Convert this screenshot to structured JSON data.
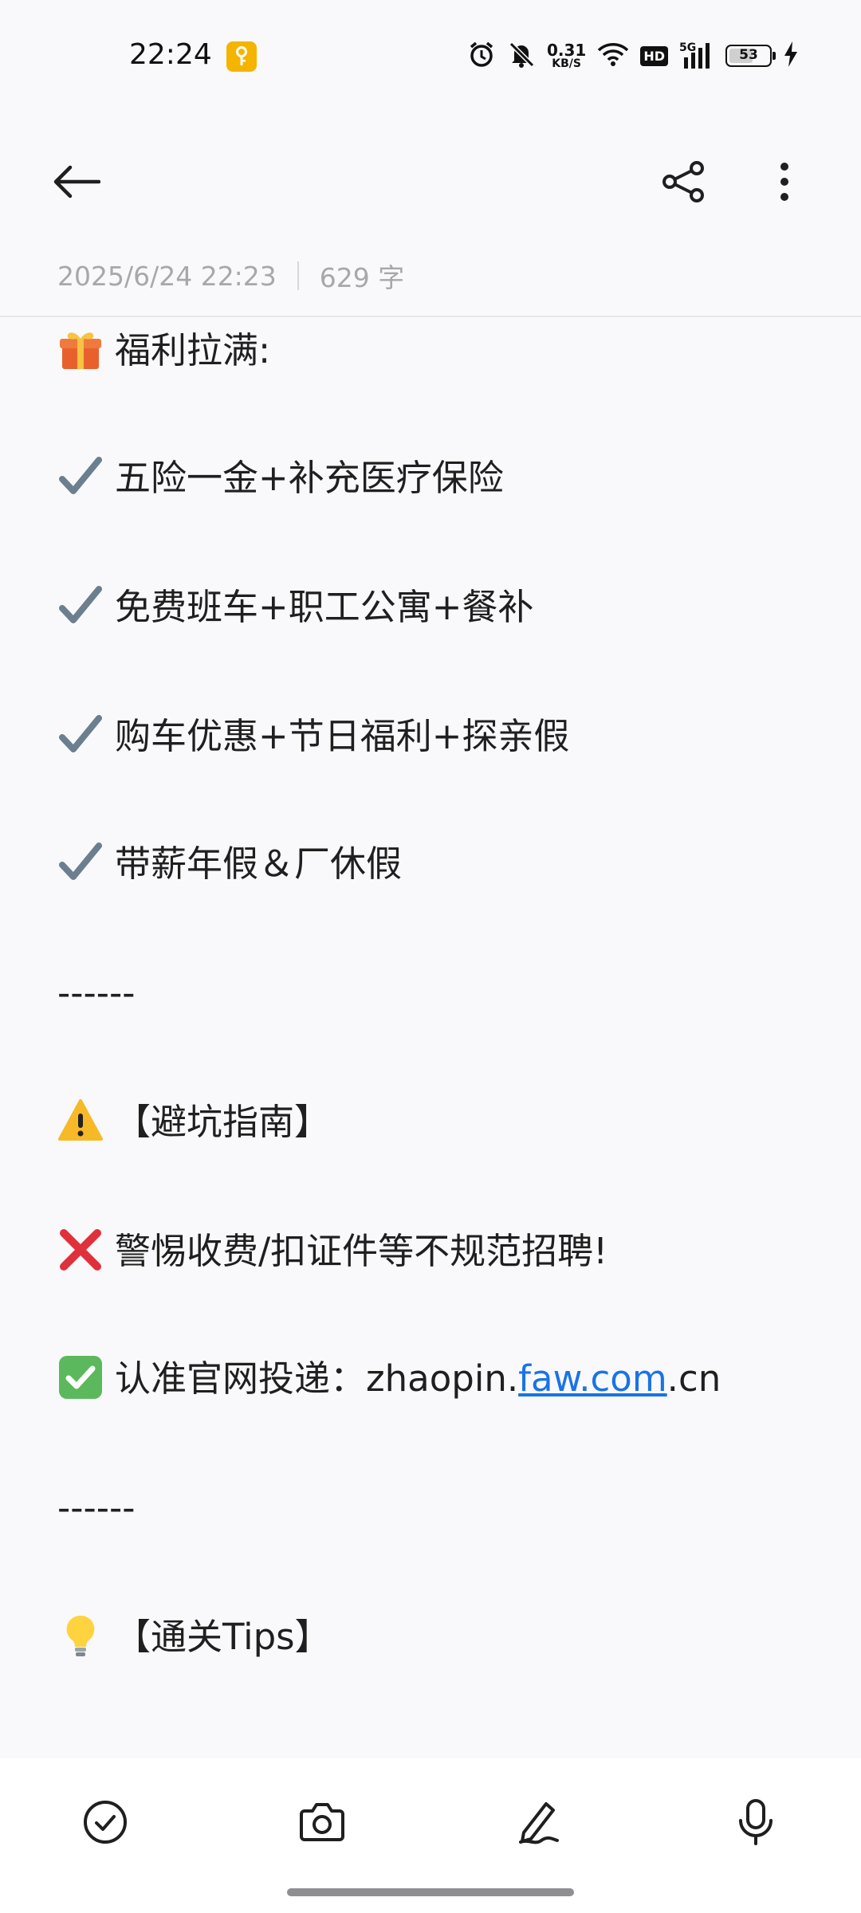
{
  "status_bar": {
    "time": "22:24",
    "net_speed_value": "0.31",
    "net_speed_unit": "KB/S",
    "hd_label": "HD",
    "network_label": "5G",
    "battery_level": "53",
    "battery_fraction": 0.53,
    "icons": [
      "key-icon",
      "alarm-icon",
      "mute-icon",
      "wifi-icon",
      "signal-icon",
      "battery-icon",
      "charging-icon"
    ]
  },
  "app_bar": {
    "icons": [
      "back-arrow-icon",
      "share-icon",
      "more-vertical-icon"
    ]
  },
  "meta": {
    "datetime": "2025/6/24 22:23",
    "word_count": "629 字"
  },
  "note": {
    "lines": [
      {
        "emoji": "gift-icon",
        "text": "福利拉满:"
      },
      {
        "emoji": "check-mark-icon",
        "text": "五险一金+补充医疗保险"
      },
      {
        "emoji": "check-mark-icon",
        "text": "免费班车+职工公寓+餐补"
      },
      {
        "emoji": "check-mark-icon",
        "text": "购车优惠+节日福利+探亲假"
      },
      {
        "emoji": "check-mark-icon",
        "text": "带薪年假＆厂休假"
      },
      {
        "text": "------"
      },
      {
        "emoji": "warning-icon",
        "text": "【避坑指南】"
      },
      {
        "emoji": "cross-mark-icon",
        "text": "警惕收费/扣证件等不规范招聘!"
      },
      {
        "emoji": "check-box-icon",
        "text_before": "认准官网投递：zhaopin.",
        "link": "faw.com",
        "text_after": ".cn"
      },
      {
        "text": "------"
      },
      {
        "emoji": "light-bulb-icon",
        "text": "【通关Tips】"
      }
    ]
  },
  "toolbar": {
    "icons": [
      "checklist-icon",
      "camera-icon",
      "handwriting-icon",
      "microphone-icon"
    ]
  },
  "colors": {
    "background": "#f9f9fb",
    "link": "#1a73e8",
    "meta_text": "#a7a7ac",
    "key_badge": "#f5b400"
  }
}
